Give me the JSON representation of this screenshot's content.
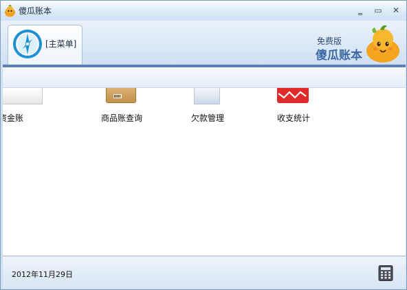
{
  "window": {
    "title": "傻瓜账本",
    "controls": {
      "minimize": "‗",
      "maximize": "▭",
      "close": "✕"
    }
  },
  "header": {
    "tab_label": "[主菜单]",
    "brand_edition": "免费版",
    "brand_name": "傻瓜账本"
  },
  "modules": [
    {
      "label": "资金账",
      "icon": "ledger-icon"
    },
    {
      "label": "商品账查询",
      "icon": "barcode-box-icon"
    },
    {
      "label": "欠款管理",
      "icon": "document-icon"
    },
    {
      "label": "收支统计",
      "icon": "chart-card-icon"
    }
  ],
  "status": {
    "date": "2012年11月29日",
    "calculator_icon": "calculator-icon"
  },
  "colors": {
    "accent": "#5b7fb8",
    "window_bg": "#cfe0f3",
    "brand_text": "#3d6aa4",
    "red_tile": "#e02a2a"
  }
}
